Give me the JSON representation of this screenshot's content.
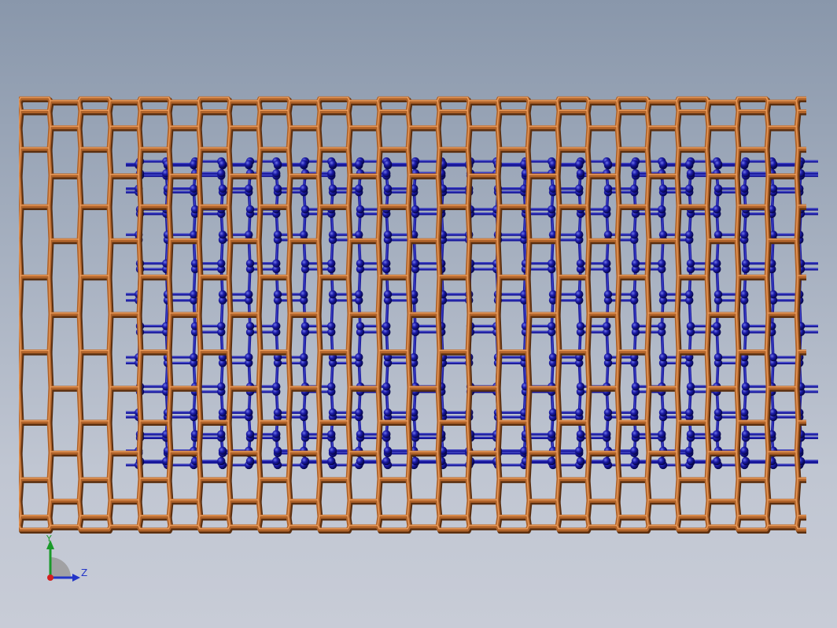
{
  "viewport": {
    "background_top": "#8997ab",
    "background_bottom": "#c8ccd7"
  },
  "model": {
    "outer_tube_color": "#b0632a",
    "inner_tube_color": "#17179a",
    "outer_tube_structure": "hexagonal-lattice",
    "inner_tube_structure": "ball-and-stick-hexagonal-lattice"
  },
  "triad": {
    "y_label": "Y",
    "z_label": "Z",
    "y_color": "#1a9a2a",
    "z_color": "#2335c8",
    "x_color": "#d42020"
  }
}
